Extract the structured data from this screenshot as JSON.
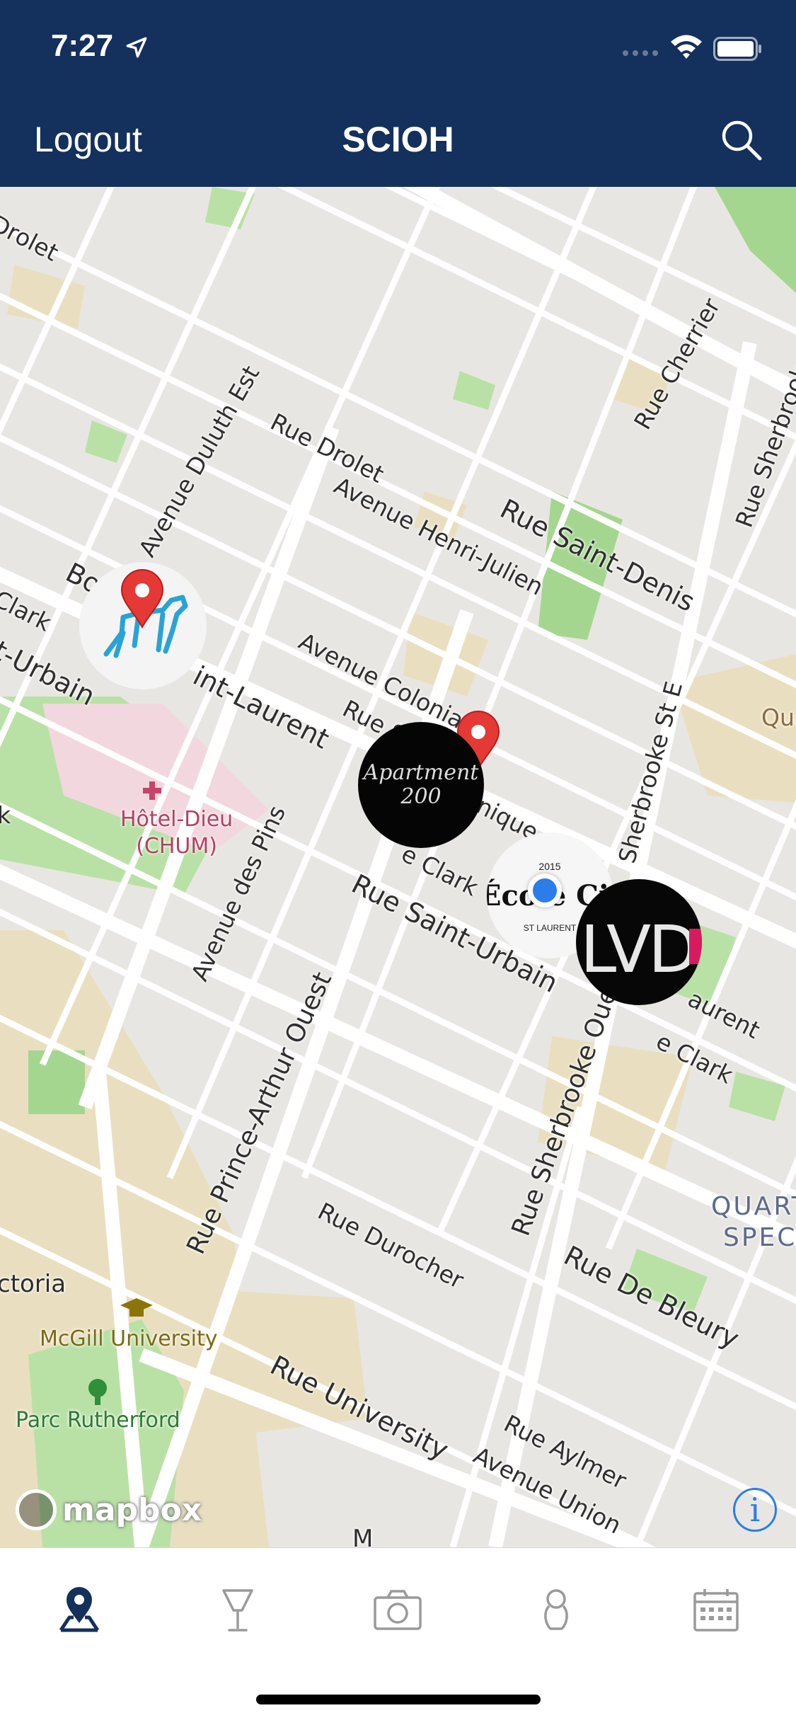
{
  "status_bar": {
    "time": "7:27"
  },
  "nav": {
    "left_label": "Logout",
    "title": "SCIOH",
    "search_icon": "search-icon"
  },
  "map": {
    "streets": {
      "drolet_top": "Drolet",
      "duluth": "Avenue Duluth Est",
      "rue_drolet": "Rue Drolet",
      "henri_julien": "Avenue Henri-Julien",
      "saint_denis": "Rue Saint-Denis",
      "cherrier": "Rue Cherrier",
      "sherbrooke_right": "Rue Sherbrooke E",
      "clark_left": "Clark",
      "bo_fragment": "Bo",
      "saint_laurent_fragment": "int-Laurent",
      "urbain_left": "t-Urbain",
      "coloniale": "Avenue Coloniale",
      "rue_s_fragment": "Rue S",
      "inique_fragment": "inique",
      "clark_center": "e Clark",
      "sherbrooke_st_e": "Sherbrooke St E",
      "des_pins": "Avenue des Pins",
      "saint_urbain": "Rue Saint-Urbain",
      "aurent_right": "aurent",
      "clark_right": "e Clark",
      "prince_arthur": "Rue Prince-Arthur Ouest",
      "sherbrooke_ouest": "Rue Sherbrooke Ouest",
      "durocher": "Rue Durocher",
      "de_bleury": "Rue De Bleury",
      "university": "Rue University",
      "aylmer": "Rue Aylmer",
      "union": "Avenue Union",
      "ctoria": "ctoria",
      "qua": "Qua",
      "quart": "QUART",
      "spec": "SPEC",
      "m_fragment": "M",
      "k_fragment": "k"
    },
    "places": {
      "hotel_dieu": "Hôtel-Dieu\n(CHUM)",
      "mcgill": "McGill University",
      "parc_rutherford": "Parc Rutherford"
    },
    "markers": {
      "apartment": "Apartment\n200",
      "ecole_year": "2015",
      "ecole_name": "École Civ",
      "ecole_sub": "ST LAURENT",
      "lvd": "LVD"
    },
    "attribution": "mapbox",
    "info": "i"
  },
  "tabs": [
    {
      "name": "map-pin-icon",
      "active": true
    },
    {
      "name": "cocktail-glass-icon",
      "active": false
    },
    {
      "name": "camera-icon",
      "active": false
    },
    {
      "name": "person-icon",
      "active": false
    },
    {
      "name": "calendar-icon",
      "active": false
    }
  ],
  "colors": {
    "nav_bg": "#14305c",
    "active_tab": "#14305c",
    "inactive_tab": "#9a9a9a",
    "pin_red": "#e53935",
    "user_dot": "#2b7de9"
  }
}
